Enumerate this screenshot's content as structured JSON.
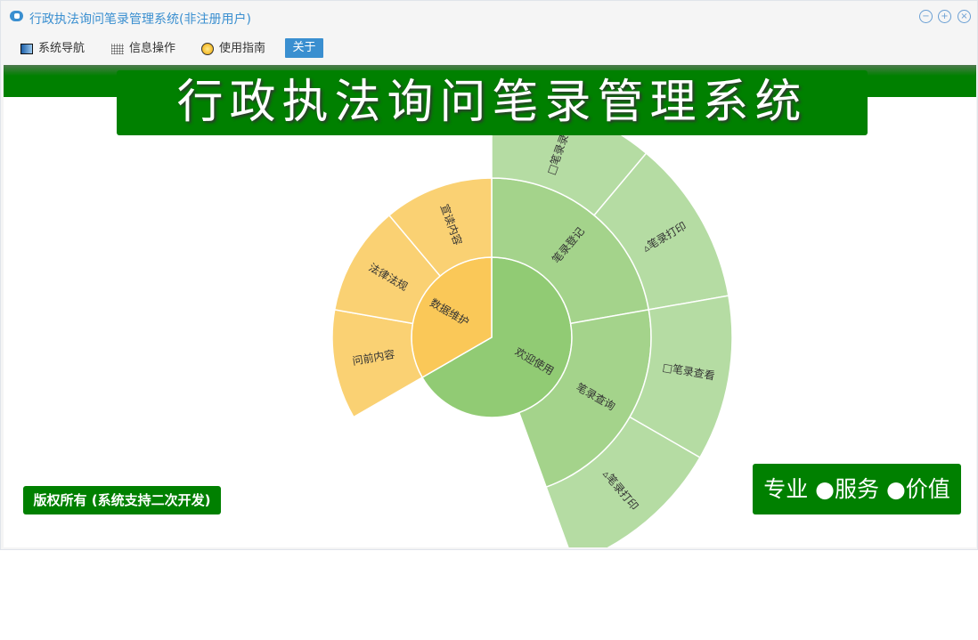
{
  "window": {
    "title": "行政执法询问笔录管理系统(非注册用户)",
    "controls": [
      "minimize",
      "maximize",
      "close"
    ]
  },
  "menu": {
    "items": [
      {
        "label": "系统导航",
        "icon": "monitor-icon"
      },
      {
        "label": "信息操作",
        "icon": "grid-icon"
      },
      {
        "label": "使用指南",
        "icon": "help-icon"
      },
      {
        "label": "关于",
        "active": true
      }
    ]
  },
  "banner": {
    "title": "行政执法询问笔录管理系统"
  },
  "footer": {
    "copyright": "版权所有 (系统支持二次开发)",
    "slogan": "专业 ●服务 ●价值"
  },
  "colors": {
    "brand_green": "#008000",
    "accent_blue": "#3a8fd0"
  },
  "chart_data": {
    "type": "sunburst",
    "data": [
      {
        "name": "欢迎使用",
        "value": 6,
        "color": "#91cb74",
        "children": [
          {
            "name": "笔录登记",
            "value": 2,
            "children": [
              {
                "name": "□笔录录入",
                "value": 1
              },
              {
                "name": "▵笔录打印",
                "value": 1
              }
            ]
          },
          {
            "name": "笔录查询",
            "value": 2,
            "children": [
              {
                "name": "□笔录查看",
                "value": 1
              },
              {
                "name": "▵笔录打印",
                "value": 1
              }
            ]
          }
        ]
      },
      {
        "name": "数据维护",
        "value": 3,
        "color": "#fac858",
        "children": [
          {
            "name": "问前内容",
            "value": 1
          },
          {
            "name": "法律法规",
            "value": 1
          },
          {
            "name": "宣读内容",
            "value": 1
          }
        ]
      }
    ]
  }
}
